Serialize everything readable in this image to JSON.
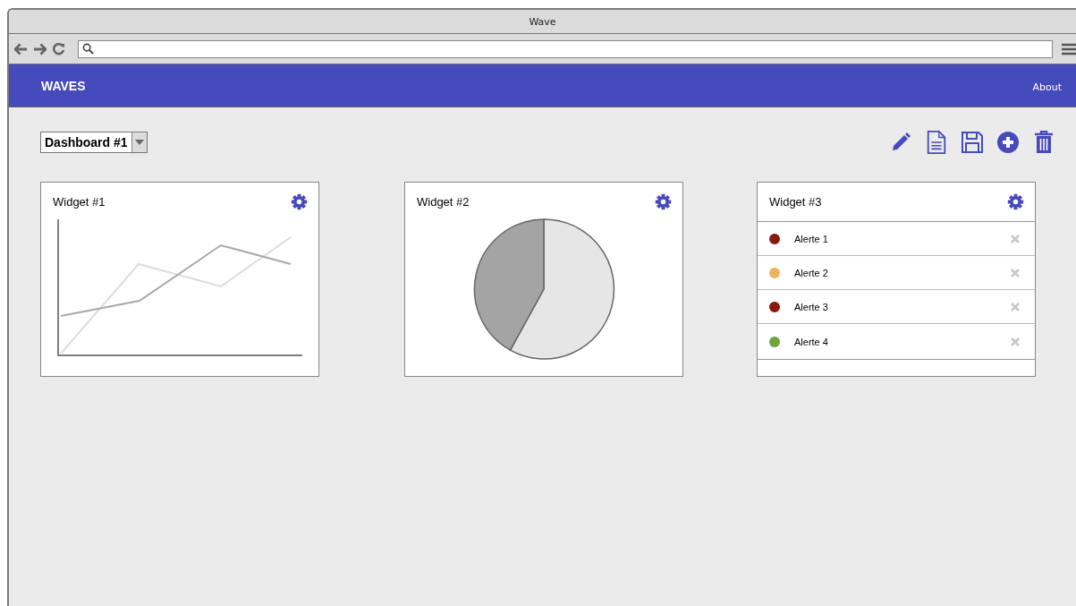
{
  "window": {
    "title": "Wave"
  },
  "navbar": {
    "brand": "WAVES",
    "links": [
      "About"
    ]
  },
  "dashboard_select": {
    "value": "Dashboard #1"
  },
  "widgets": [
    {
      "kind": "line",
      "title": "Widget #1"
    },
    {
      "kind": "pie",
      "title": "Widget #2"
    },
    {
      "kind": "alerts",
      "title": "Widget #3",
      "alerts": [
        {
          "label": "Alerte 1",
          "color": "#8b1a0e"
        },
        {
          "label": "Alerte 2",
          "color": "#eeb260"
        },
        {
          "label": "Alerte 3",
          "color": "#8b1a0e"
        },
        {
          "label": "Alerte 4",
          "color": "#6fa43e"
        }
      ]
    }
  ]
}
